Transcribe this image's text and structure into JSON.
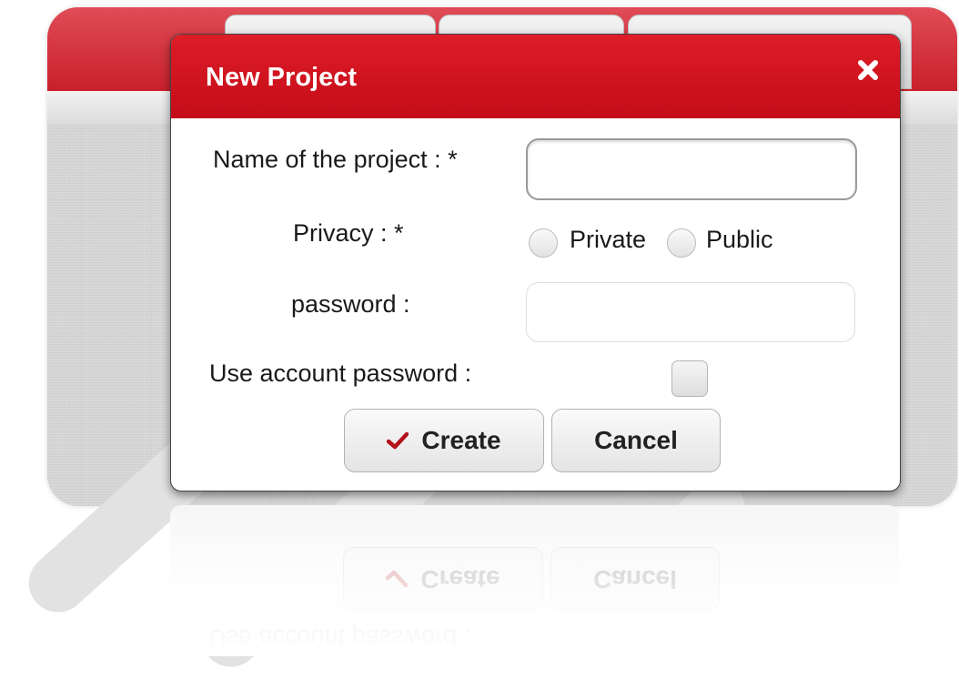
{
  "dialog": {
    "title": "New Project",
    "close_icon": "close-icon",
    "fields": {
      "name_label": "Name of the project :  *",
      "name_value": "",
      "privacy_label": "Privacy :  *",
      "privacy_options": [
        "Private",
        "Public"
      ],
      "privacy_selected": null,
      "password_label": "password :",
      "password_value": "",
      "use_account_password_label": "Use account password :",
      "use_account_password_checked": false
    },
    "buttons": {
      "create_label": "Create",
      "create_icon": "check-icon",
      "cancel_label": "Cancel"
    }
  },
  "colors": {
    "titlebar": "#d0111c",
    "header_bg": "#d12a35",
    "check_icon": "#b3121b"
  }
}
